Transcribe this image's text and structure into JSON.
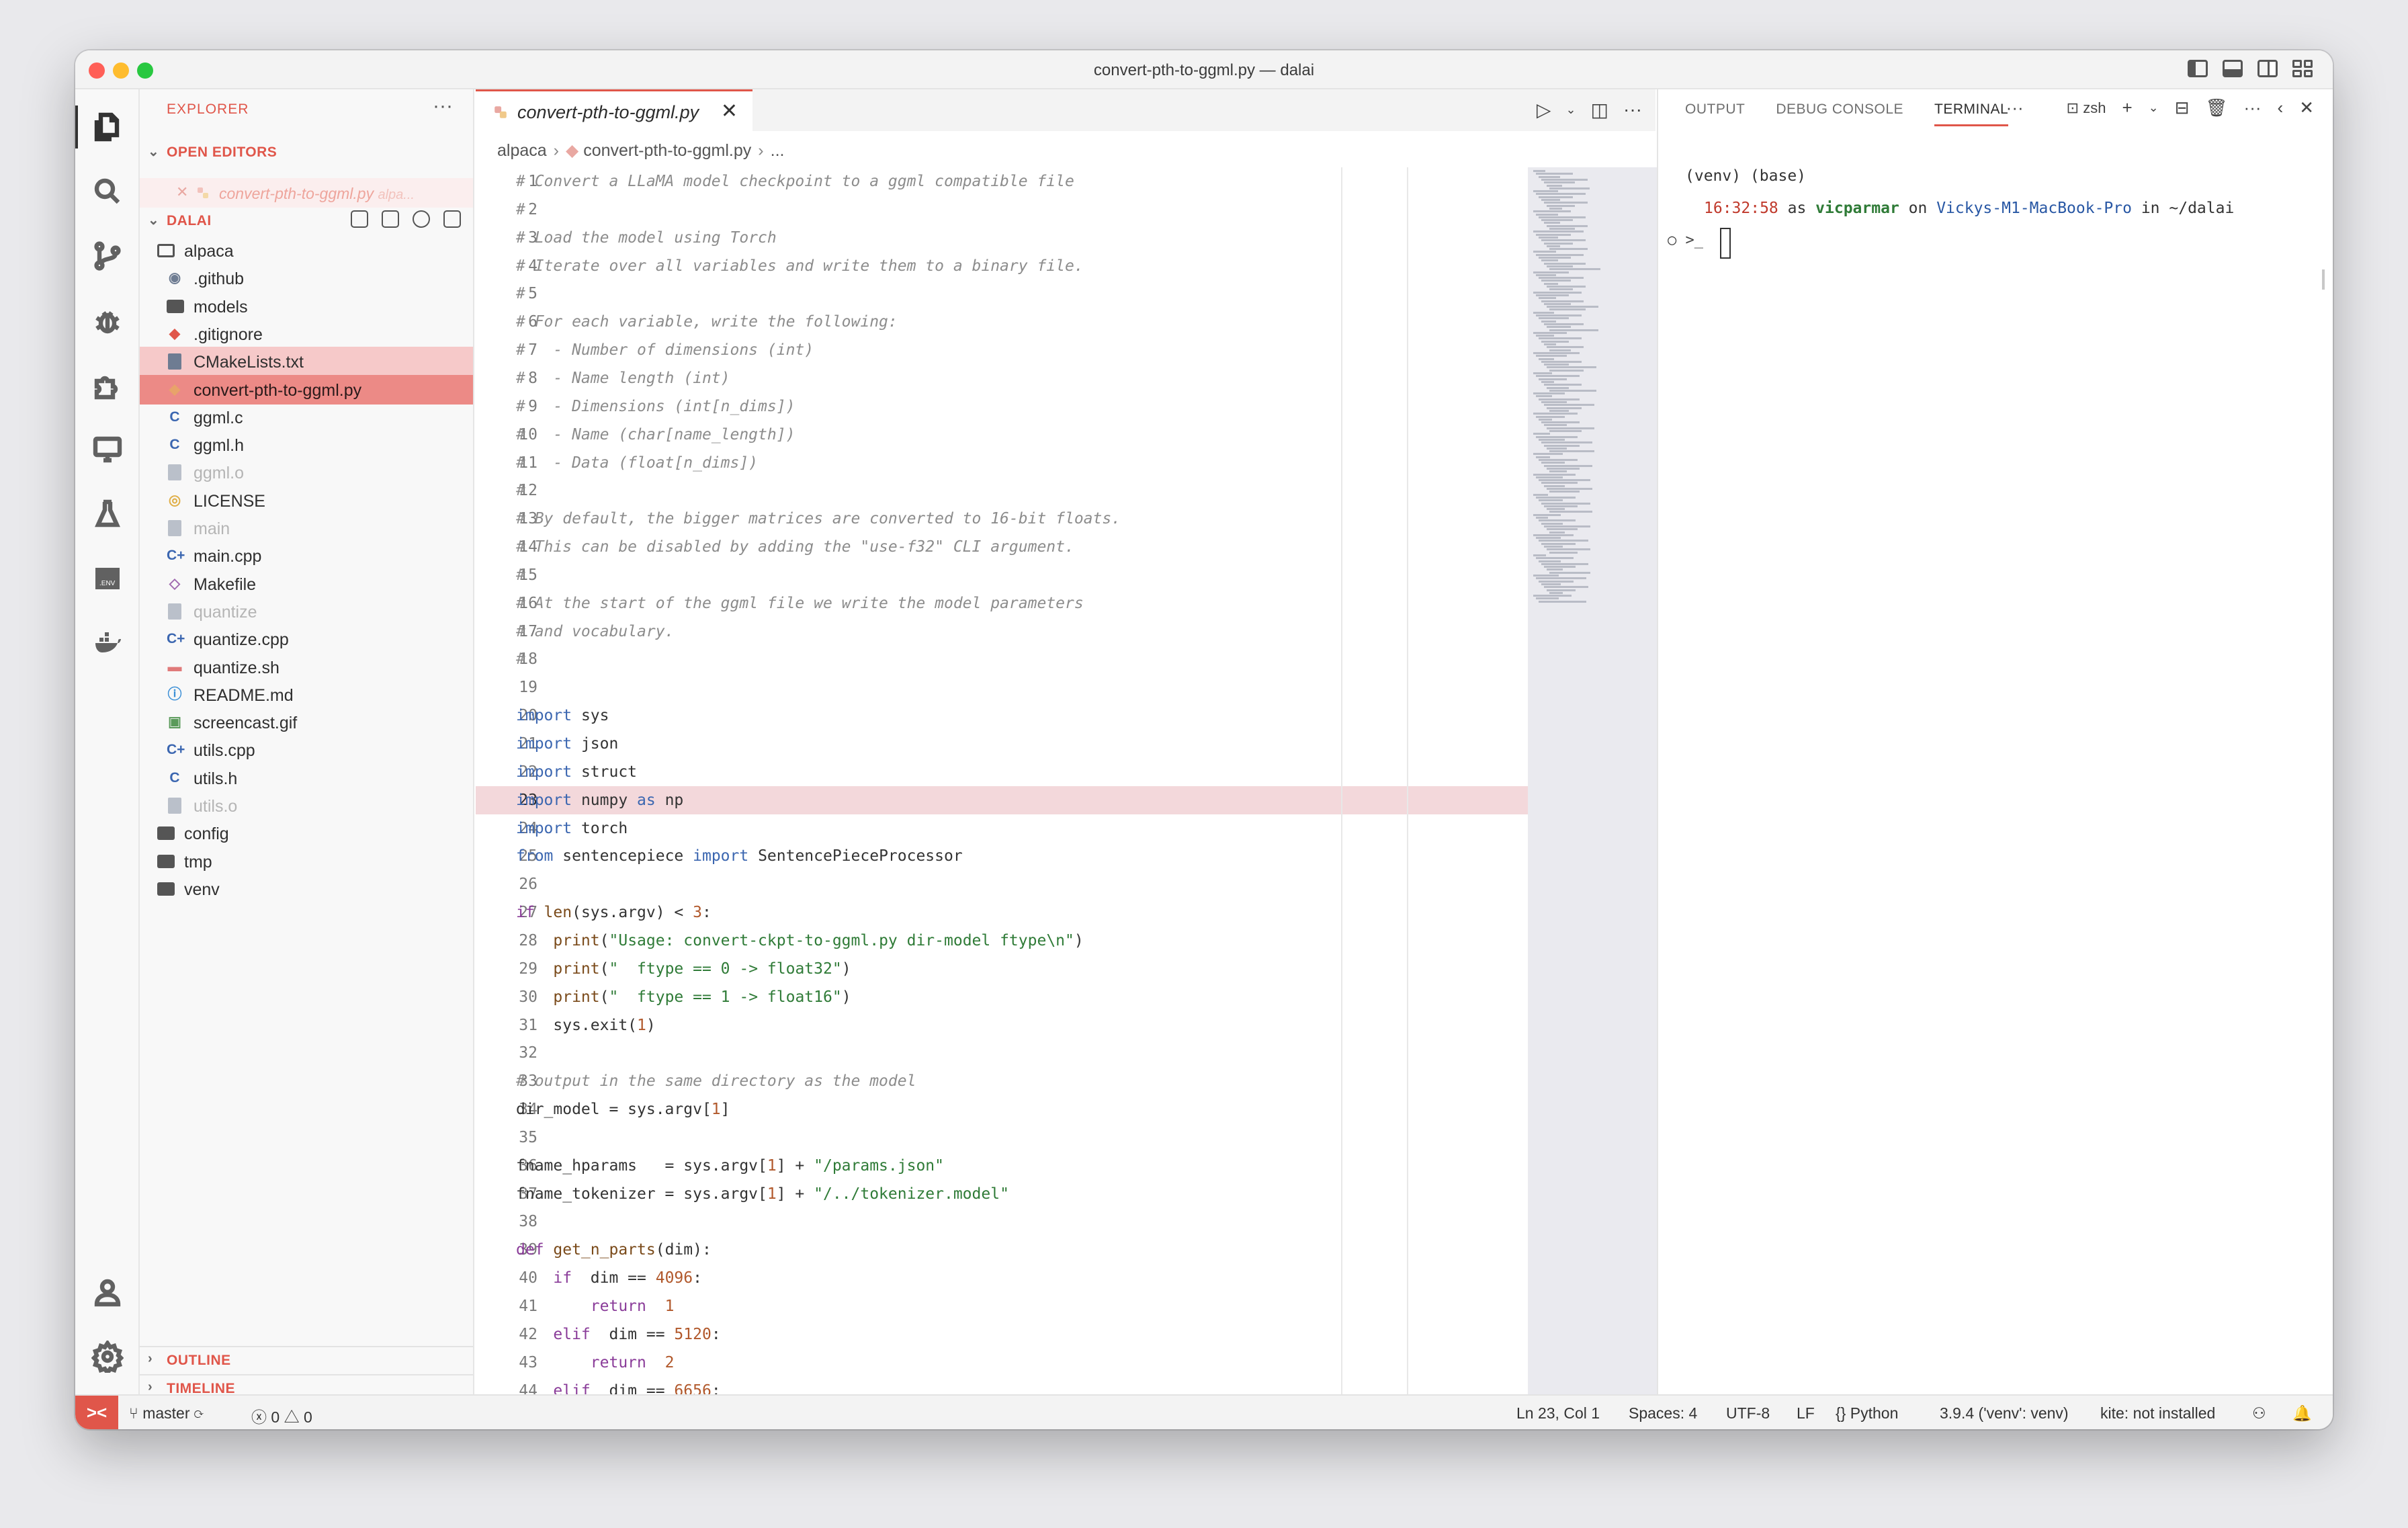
{
  "window": {
    "title": "convert-pth-to-ggml.py — dalai"
  },
  "activity_bar": [
    "files-icon",
    "search-icon",
    "source-control-icon",
    "debug-icon",
    "extensions-icon",
    "remote-explorer-icon",
    "testing-icon",
    "env-icon",
    "docker-icon",
    "account-icon",
    "settings-icon"
  ],
  "sidebar": {
    "title": "EXPLORER",
    "more": "···",
    "open_editors": {
      "label": "OPEN EDITORS",
      "item_name": "convert-pth-to-ggml.py",
      "item_path": "alpa..."
    },
    "project": {
      "label": "DALAI"
    },
    "tree": [
      {
        "name": "alpaca",
        "type": "folder-outline",
        "indent": 0,
        "state": ""
      },
      {
        "name": ".github",
        "type": "github",
        "indent": 1,
        "state": ""
      },
      {
        "name": "models",
        "type": "folder",
        "indent": 1,
        "state": ""
      },
      {
        "name": ".gitignore",
        "type": "git",
        "indent": 1,
        "state": ""
      },
      {
        "name": "CMakeLists.txt",
        "type": "txt",
        "indent": 1,
        "state": "sel-light"
      },
      {
        "name": "convert-pth-to-ggml.py",
        "type": "py",
        "indent": 1,
        "state": "sel"
      },
      {
        "name": "ggml.c",
        "type": "c",
        "indent": 1,
        "state": ""
      },
      {
        "name": "ggml.h",
        "type": "c",
        "indent": 1,
        "state": ""
      },
      {
        "name": "ggml.o",
        "type": "bin",
        "indent": 1,
        "state": "dim"
      },
      {
        "name": "LICENSE",
        "type": "license",
        "indent": 1,
        "state": ""
      },
      {
        "name": "main",
        "type": "bin",
        "indent": 1,
        "state": "dim"
      },
      {
        "name": "main.cpp",
        "type": "cpp",
        "indent": 1,
        "state": ""
      },
      {
        "name": "Makefile",
        "type": "make",
        "indent": 1,
        "state": ""
      },
      {
        "name": "quantize",
        "type": "bin",
        "indent": 1,
        "state": "dim"
      },
      {
        "name": "quantize.cpp",
        "type": "cpp",
        "indent": 1,
        "state": ""
      },
      {
        "name": "quantize.sh",
        "type": "sh",
        "indent": 1,
        "state": ""
      },
      {
        "name": "README.md",
        "type": "info",
        "indent": 1,
        "state": ""
      },
      {
        "name": "screencast.gif",
        "type": "img",
        "indent": 1,
        "state": ""
      },
      {
        "name": "utils.cpp",
        "type": "cpp",
        "indent": 1,
        "state": ""
      },
      {
        "name": "utils.h",
        "type": "c",
        "indent": 1,
        "state": ""
      },
      {
        "name": "utils.o",
        "type": "bin",
        "indent": 1,
        "state": "dim"
      },
      {
        "name": "config",
        "type": "folder",
        "indent": 0,
        "state": ""
      },
      {
        "name": "tmp",
        "type": "folder",
        "indent": 0,
        "state": ""
      },
      {
        "name": "venv",
        "type": "folder",
        "indent": 0,
        "state": ""
      }
    ],
    "outline": "OUTLINE",
    "timeline": "TIMELINE"
  },
  "editor": {
    "tab": "convert-pth-to-ggml.py",
    "breadcrumb": [
      "alpaca",
      "convert-pth-to-ggml.py",
      "..."
    ],
    "current_line": 23,
    "lines": [
      [
        [
          "c",
          "# Convert a LLaMA model checkpoint to a ggml compatible file"
        ]
      ],
      [
        [
          "c",
          "#"
        ]
      ],
      [
        [
          "c",
          "# Load the model using Torch"
        ]
      ],
      [
        [
          "c",
          "# Iterate over all variables and write them to a binary file."
        ]
      ],
      [
        [
          "c",
          "#"
        ]
      ],
      [
        [
          "c",
          "# For each variable, write the following:"
        ]
      ],
      [
        [
          "c",
          "#   - Number of dimensions (int)"
        ]
      ],
      [
        [
          "c",
          "#   - Name length (int)"
        ]
      ],
      [
        [
          "c",
          "#   - Dimensions (int[n_dims])"
        ]
      ],
      [
        [
          "c",
          "#   - Name (char[name_length])"
        ]
      ],
      [
        [
          "c",
          "#   - Data (float[n_dims])"
        ]
      ],
      [
        [
          "c",
          "#"
        ]
      ],
      [
        [
          "c",
          "# By default, the bigger matrices are converted to 16-bit floats."
        ]
      ],
      [
        [
          "c",
          "# This can be disabled by adding the \"use-f32\" CLI argument."
        ]
      ],
      [
        [
          "c",
          "#"
        ]
      ],
      [
        [
          "c",
          "# At the start of the ggml file we write the model parameters"
        ]
      ],
      [
        [
          "c",
          "# and vocabulary."
        ]
      ],
      [
        [
          "c",
          "#"
        ]
      ],
      [],
      [
        [
          "k",
          "import"
        ],
        [
          "",
          "sys"
        ]
      ],
      [
        [
          "k",
          "import"
        ],
        [
          "",
          "json"
        ]
      ],
      [
        [
          "k",
          "import"
        ],
        [
          "",
          "struct"
        ]
      ],
      [
        [
          "k",
          "import"
        ],
        [
          "",
          "numpy "
        ],
        [
          "k",
          "as"
        ],
        [
          "",
          "np"
        ]
      ],
      [
        [
          "k",
          "import"
        ],
        [
          "",
          "torch"
        ]
      ],
      [
        [
          "k",
          "from"
        ],
        [
          "",
          "sentencepiece "
        ],
        [
          "k",
          "import"
        ],
        [
          "",
          "SentencePieceProcessor"
        ]
      ],
      [],
      [
        [
          "k2",
          "if "
        ],
        [
          "f",
          "len"
        ],
        [
          "",
          "(sys.argv) < "
        ],
        [
          "n",
          "3"
        ],
        [
          "",
          ":"
        ]
      ],
      [
        [
          "",
          "    "
        ],
        [
          "f",
          "print"
        ],
        [
          "",
          "("
        ],
        [
          "s",
          "\"Usage: convert-ckpt-to-ggml.py dir-model ftype\\n\""
        ],
        [
          "",
          ")"
        ]
      ],
      [
        [
          "",
          "    "
        ],
        [
          "f",
          "print"
        ],
        [
          "",
          "("
        ],
        [
          "s",
          "\"  ftype == 0 -> float32\""
        ],
        [
          "",
          ")"
        ]
      ],
      [
        [
          "",
          "    "
        ],
        [
          "f",
          "print"
        ],
        [
          "",
          "("
        ],
        [
          "s",
          "\"  ftype == 1 -> float16\""
        ],
        [
          "",
          ")"
        ]
      ],
      [
        [
          "",
          "    sys.exit("
        ],
        [
          "n",
          "1"
        ],
        [
          "",
          ")"
        ]
      ],
      [],
      [
        [
          "c",
          "# output in the same directory as the model"
        ]
      ],
      [
        [
          "",
          "dir_model = sys.argv["
        ],
        [
          "n",
          "1"
        ],
        [
          "",
          "]"
        ]
      ],
      [],
      [
        [
          "",
          "fname_hparams   = sys.argv["
        ],
        [
          "n",
          "1"
        ],
        [
          "",
          "] + "
        ],
        [
          "s",
          "\"/params.json\""
        ]
      ],
      [
        [
          "",
          "fname_tokenizer = sys.argv["
        ],
        [
          "n",
          "1"
        ],
        [
          "",
          "] + "
        ],
        [
          "s",
          "\"/../tokenizer.model\""
        ]
      ],
      [],
      [
        [
          "k2",
          "def "
        ],
        [
          "f",
          "get_n_parts"
        ],
        [
          "",
          "(dim):"
        ]
      ],
      [
        [
          "",
          "    "
        ],
        [
          "k2",
          "if"
        ],
        [
          "",
          " dim == "
        ],
        [
          "n",
          "4096"
        ],
        [
          "",
          ":"
        ]
      ],
      [
        [
          "",
          "        "
        ],
        [
          "k2",
          "return"
        ],
        [
          "",
          " "
        ],
        [
          "n",
          "1"
        ]
      ],
      [
        [
          "",
          "    "
        ],
        [
          "k2",
          "elif"
        ],
        [
          "",
          " dim == "
        ],
        [
          "n",
          "5120"
        ],
        [
          "",
          ":"
        ]
      ],
      [
        [
          "",
          "        "
        ],
        [
          "k2",
          "return"
        ],
        [
          "",
          " "
        ],
        [
          "n",
          "2"
        ]
      ],
      [
        [
          "",
          "    "
        ],
        [
          "k2",
          "elif"
        ],
        [
          "",
          " dim == "
        ],
        [
          "n",
          "6656"
        ],
        [
          "",
          ":"
        ]
      ]
    ]
  },
  "panel": {
    "tabs": [
      "OUTPUT",
      "DEBUG CONSOLE",
      "TERMINAL"
    ],
    "active_tab": "TERMINAL",
    "shell": "zsh",
    "term_line1": "(venv) (base)",
    "term_time": "16:32:58",
    "term_as": " as ",
    "term_user": "vicparmar",
    "term_on": " on ",
    "term_host": "Vickys-M1-MacBook-Pro",
    "term_in": " in ~/dalai",
    "prompt": ">_"
  },
  "status": {
    "branch": "master",
    "errors": "0",
    "warnings": "0",
    "position": "Ln 23, Col 1",
    "spaces": "Spaces: 4",
    "encoding": "UTF-8",
    "eol": "LF",
    "language": "Python",
    "interpreter": "3.9.4 ('venv': venv)",
    "kite": "kite: not installed"
  },
  "colors": {
    "accent": "#e0564a",
    "selection": "#ec8a86",
    "current_line": "#f3d8db"
  }
}
